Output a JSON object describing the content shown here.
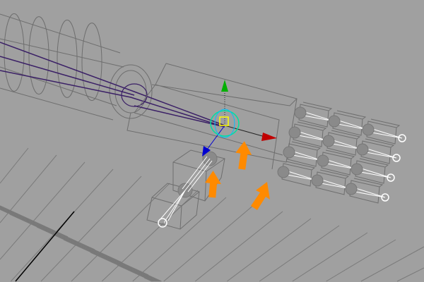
{
  "viewport": {
    "background_color": "#a0a0a0",
    "grid_color": "#7a7a7a",
    "wire_color": "#6e6e6e",
    "skeleton_color": "#3a1f66",
    "annotation_arrow_color": "#ff8a00",
    "manipulator": {
      "x_color": "#c00000",
      "y_color": "#00b000",
      "z_color": "#0000d0",
      "center_color": "#ffff00",
      "rotate_ring_color": "#00e0a0"
    }
  }
}
